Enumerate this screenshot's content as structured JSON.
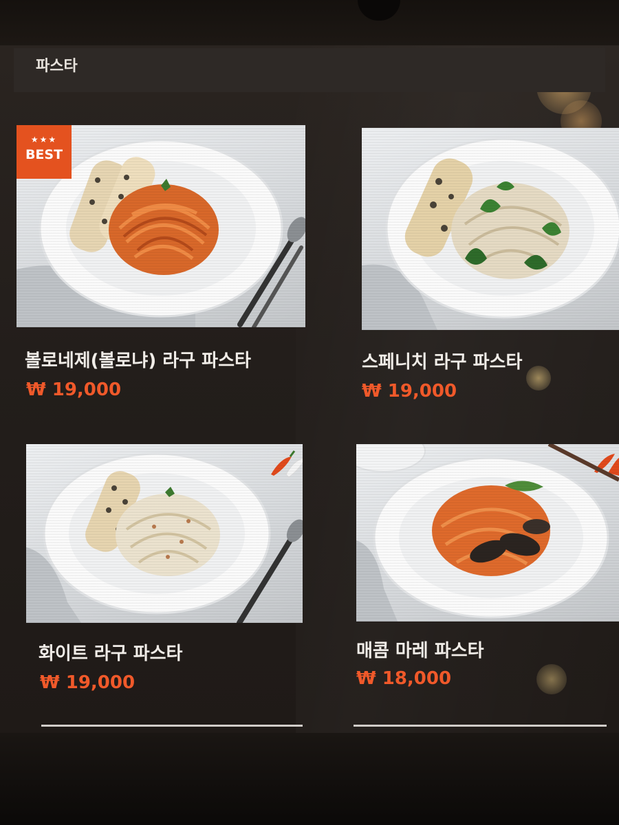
{
  "category": {
    "title": "파스타"
  },
  "menu_items": [
    {
      "name": "볼로네제(볼로냐) 라구 파스타",
      "price": "₩ 19,000",
      "badge": {
        "stars": "★★★",
        "label": "BEST"
      }
    },
    {
      "name": "스페니치 라구 파스타",
      "price": "₩ 19,000"
    },
    {
      "name": "화이트 라구 파스타",
      "price": "₩ 19,000"
    },
    {
      "name": "매콤 마레 파스타",
      "price": "₩ 18,000"
    }
  ],
  "colors": {
    "price": "#f0592a",
    "badge_bg": "#e4521f",
    "name_text": "#f1ede8",
    "screen_bg": "#231e1b"
  },
  "icons": [
    "chili-pepper-icon",
    "spoon-fork-icon"
  ]
}
